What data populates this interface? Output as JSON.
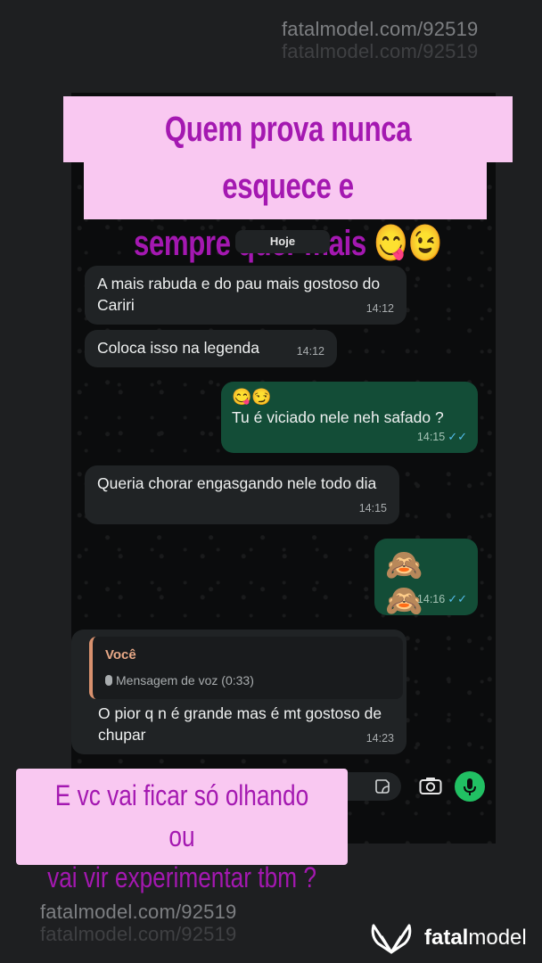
{
  "watermark": {
    "text": "fatalmodel.com/92519"
  },
  "headline": {
    "line1": "Quem prova nunca esquece e",
    "line2": "sempre quer mais 😋😉"
  },
  "chat": {
    "date_label": "Hoje",
    "messages": [
      {
        "dir": "in",
        "text": "A mais rabuda e do pau mais gostoso do Cariri",
        "time": "14:12"
      },
      {
        "dir": "in",
        "text": "Coloca isso na legenda",
        "time": "14:12"
      },
      {
        "dir": "out",
        "emoji": "😋😏",
        "text": "Tu é viciado nele neh safado ?",
        "time": "14:15",
        "ticks": "✓✓"
      },
      {
        "dir": "in",
        "text": "Queria chorar engasgando nele todo dia",
        "time": "14:15"
      },
      {
        "dir": "out",
        "emoji": "🙈 🙈",
        "text": "",
        "time": "14:16",
        "ticks": "✓✓"
      },
      {
        "dir": "in",
        "reply_author": "Você",
        "reply_text": "Mensagem de voz (0:33)",
        "text": "O pior q n é grande mas é mt gostoso de chupar",
        "time": "14:23"
      }
    ]
  },
  "callout": {
    "line1": "E vc vai ficar só olhando ou",
    "line2": "vai vir experimentar tbm ?"
  },
  "brand": {
    "bold": "fatal",
    "rest": "model"
  },
  "icons": {
    "camera": "camera-icon",
    "mic": "mic-icon",
    "sticker": "sticker-icon",
    "logo": "butterfly-logo-icon"
  },
  "colors": {
    "accent_pink_bg": "#f9c8f1",
    "accent_purple": "#a418b1",
    "out_bubble": "#134d37",
    "in_bubble": "#202325",
    "mic_green": "#21c063",
    "ticks_blue": "#53bdeb"
  }
}
